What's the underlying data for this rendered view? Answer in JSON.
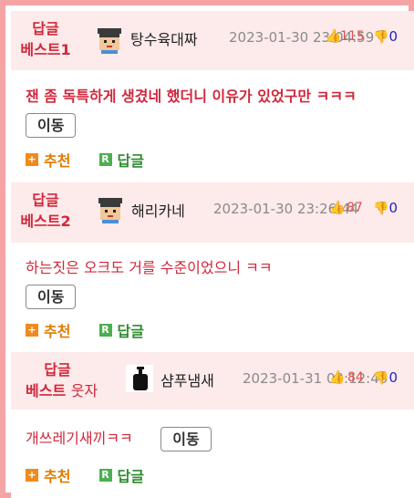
{
  "colors": {
    "border": "#f4a4a4",
    "header_bg": "#fdeaea",
    "accent_red": "#d0283c",
    "recommend_orange": "#e07b00",
    "reply_green": "#2e8b2e",
    "dislike_blue": "#1a5fb4"
  },
  "replies": [
    {
      "badge": [
        "답글",
        "베스트1"
      ],
      "badge_extra": "",
      "avatar_icon": "pixel-face-avatar",
      "nickname": "탕수육대짜",
      "time": "2023-01-30 23:04:59",
      "likes": "115",
      "dislikes": "0",
      "text": "잰 좀 독특하게 생겼네 했더니 이유가 있었구만 ㅋㅋㅋ",
      "move_label": "이동",
      "recommend_label": "추천",
      "reply_label": "답글"
    },
    {
      "badge": [
        "답글",
        "베스트2"
      ],
      "badge_extra": "",
      "avatar_icon": "pixel-face-avatar",
      "nickname": "해리카네",
      "time": "2023-01-30 23:26:44",
      "likes": "87",
      "dislikes": "0",
      "text": "하는짓은 오크도 거를 수준이었으니 ㅋㅋ",
      "move_label": "이동",
      "recommend_label": "추천",
      "reply_label": "답글"
    },
    {
      "badge": [
        "답글",
        "베스트"
      ],
      "badge_extra": "웃자",
      "avatar_icon": "shampoo-bottle-avatar",
      "nickname": "샴푸냄새",
      "time": "2023-01-31 03:12:40",
      "likes": "84",
      "dislikes": "0",
      "text": "개쓰레기새끼ㅋㅋ",
      "move_label": "이동",
      "recommend_label": "추천",
      "reply_label": "답글"
    }
  ]
}
